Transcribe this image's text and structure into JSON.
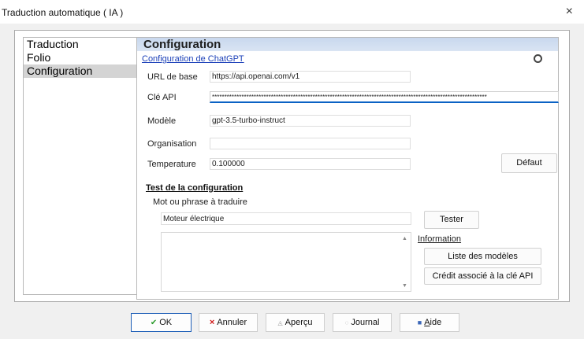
{
  "window": {
    "title": "Traduction automatique ( IA )",
    "close_glyph": "×"
  },
  "nav": {
    "items": [
      {
        "label": "Traduction"
      },
      {
        "label": "Folio"
      },
      {
        "label": "Configuration"
      }
    ]
  },
  "header": {
    "title": "Configuration"
  },
  "config": {
    "link_label": "Configuration de ChatGPT",
    "icon_name": "chatgpt-icon",
    "fields": {
      "base_url": {
        "label": "URL de base",
        "value": "https://api.openai.com/v1"
      },
      "api_key": {
        "label": "Clé API",
        "value": "****************************************************************************************************************"
      },
      "model": {
        "label": "Modèle",
        "value": "gpt-3.5-turbo-instruct"
      },
      "organisation": {
        "label": "Organisation",
        "value": ""
      },
      "temperature": {
        "label": "Temperature",
        "value": "0.100000"
      }
    },
    "default_button": "Défaut"
  },
  "test": {
    "title": "Test de la configuration",
    "prompt_label": "Mot ou phrase à traduire",
    "input_value": "Moteur électrique",
    "test_button": "Tester",
    "info_link": "Information",
    "list_models_button": "Liste des modèles",
    "credit_button": "Crédit associé à la clé API",
    "result_text": ""
  },
  "footer": {
    "ok": "OK",
    "cancel": "Annuler",
    "preview": "Aperçu",
    "journal": "Journal",
    "help_prefix": "A",
    "help_rest": "ide"
  },
  "colors": {
    "accent": "#1f5fb8",
    "link": "#1a3fb8",
    "focus": "#0a62c4",
    "nav_selected": "#d4d4d4",
    "header_band": "#cfdcf0"
  }
}
